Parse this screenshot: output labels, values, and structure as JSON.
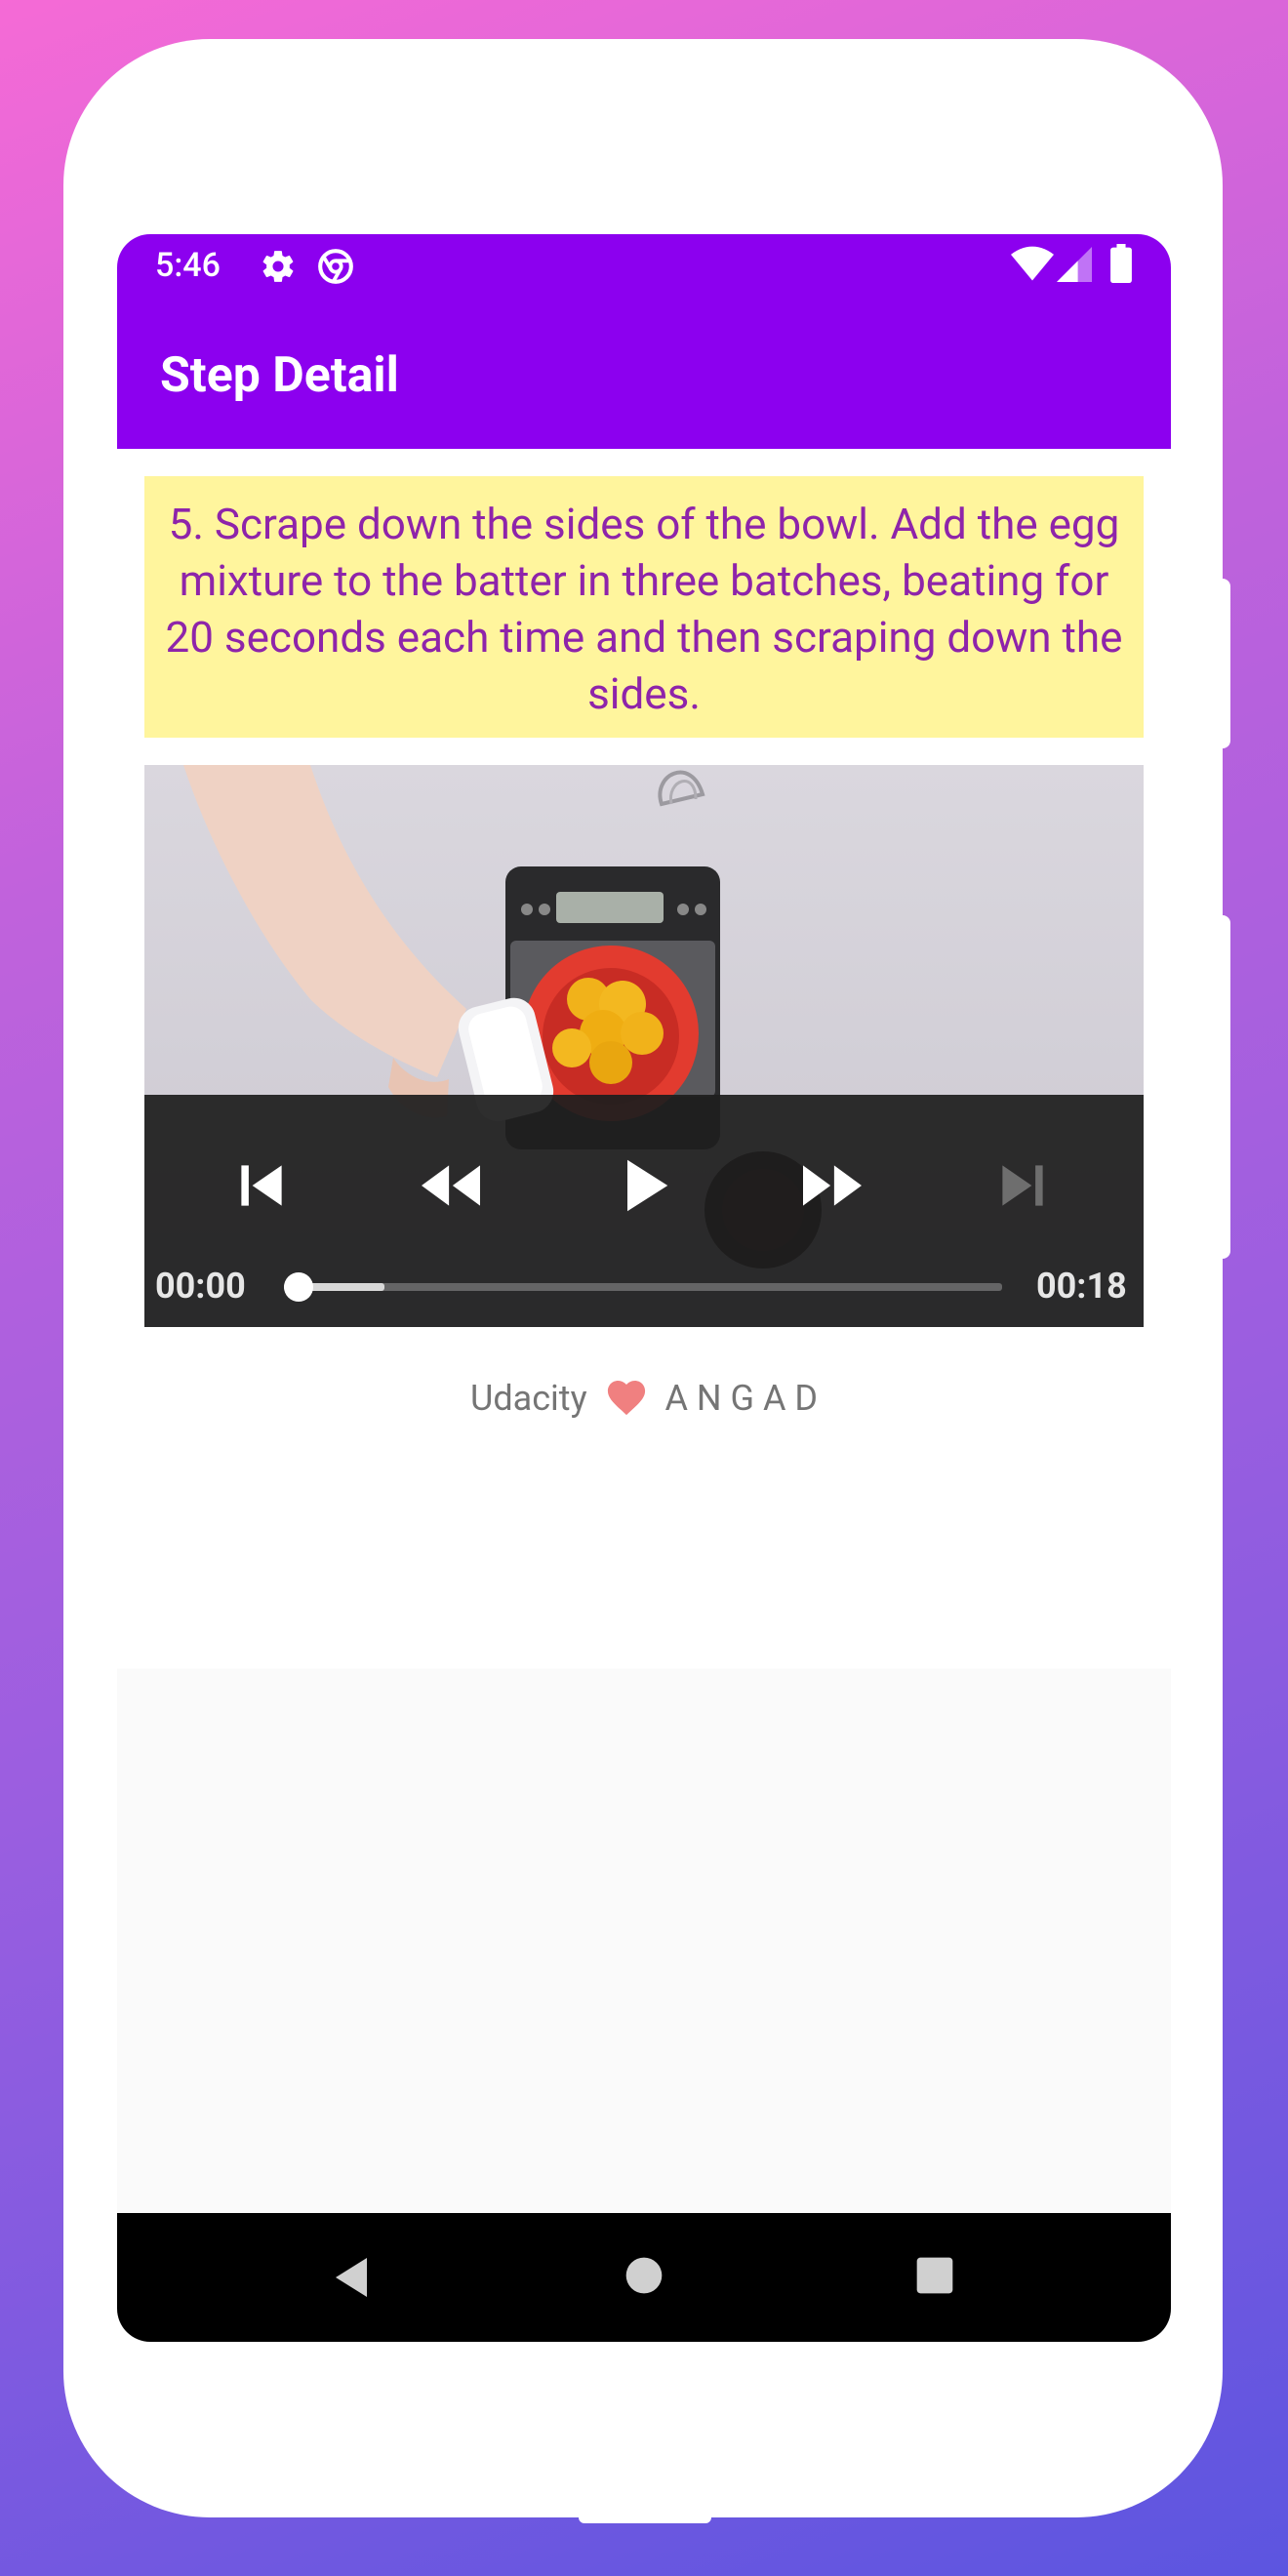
{
  "status_bar": {
    "time": "5:46",
    "icons": [
      "settings-icon",
      "chrome-icon",
      "wifi-icon",
      "signal-icon",
      "battery-icon"
    ]
  },
  "app_bar": {
    "title": "Step Detail",
    "color": "#8c00ef"
  },
  "step": {
    "description": "5. Scrape down the sides of the bowl. Add the egg mixture to the batter in three batches, beating for 20 seconds each time and then scraping down the sides.",
    "highlight_color": "#fff59d",
    "text_color": "#8e24aa"
  },
  "player": {
    "position": "00:00",
    "duration": "00:18",
    "buttons": [
      "previous-icon",
      "rewind-icon",
      "play-icon",
      "fast-forward-icon",
      "next-icon"
    ],
    "progress": 0,
    "buffered_fraction": 0.14
  },
  "footer": {
    "prefix": "Udacity",
    "name": "A N G A D",
    "heart_icon": "heart-icon"
  },
  "nav_bar": {
    "buttons": [
      "back-icon",
      "home-icon",
      "recents-icon"
    ]
  }
}
